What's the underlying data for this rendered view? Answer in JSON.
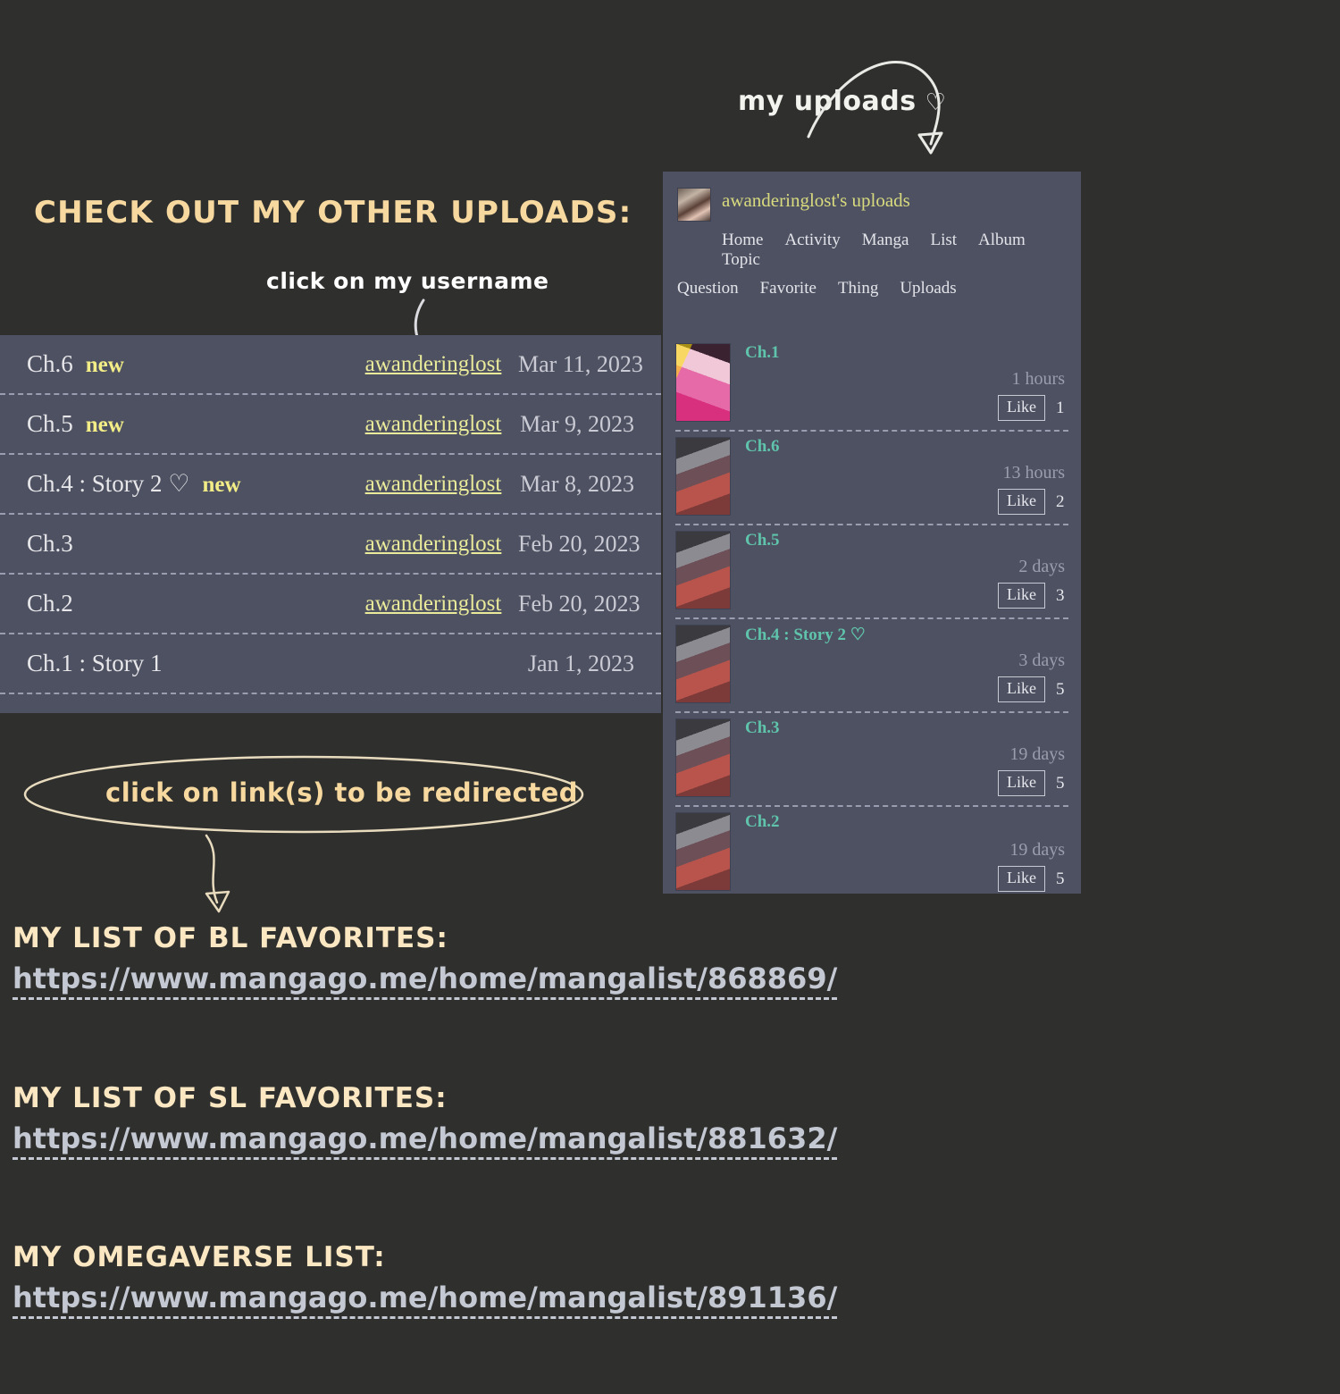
{
  "annotations": {
    "my_uploads": "my uploads",
    "my_uploads_heart": "♡",
    "check_out_heading": "CHECK OUT MY OTHER UPLOADS:",
    "click_username": "click on my username",
    "click_links": "click on link(s) to be redirected"
  },
  "chapter_table": {
    "rows": [
      {
        "title": "Ch.6",
        "badge": "new",
        "user": "awanderinglost",
        "date": "Mar 11, 2023"
      },
      {
        "title": "Ch.5",
        "badge": "new",
        "user": "awanderinglost",
        "date": "Mar 9, 2023"
      },
      {
        "title": "Ch.4 : Story 2 ♡",
        "badge": "new",
        "user": "awanderinglost",
        "date": "Mar 8, 2023"
      },
      {
        "title": "Ch.3",
        "badge": "",
        "user": "awanderinglost",
        "date": "Feb 20, 2023"
      },
      {
        "title": "Ch.2",
        "badge": "",
        "user": "awanderinglost",
        "date": "Feb 20, 2023"
      },
      {
        "title": "Ch.1 : Story 1",
        "badge": "",
        "user": "",
        "date": "Jan 1, 2023"
      }
    ]
  },
  "uploads_panel": {
    "title": "awanderinglost's uploads",
    "nav_line1": [
      {
        "label": "Home"
      },
      {
        "label": "Activity"
      },
      {
        "label": "Manga"
      },
      {
        "label": "List"
      },
      {
        "label": "Album"
      },
      {
        "label": "Topic"
      }
    ],
    "nav_line2": [
      {
        "label": "Question"
      },
      {
        "label": "Favorite"
      },
      {
        "label": "Thing"
      },
      {
        "label": "Uploads"
      }
    ],
    "like_label": "Like",
    "rows": [
      {
        "chapter": "Ch.1",
        "time": "1 hours",
        "likes": "1",
        "thumb": "manga-cover-pink"
      },
      {
        "chapter": "Ch.6",
        "time": "13 hours",
        "likes": "2",
        "thumb": "manga-cover-red"
      },
      {
        "chapter": "Ch.5",
        "time": "2 days",
        "likes": "3",
        "thumb": "manga-cover-red"
      },
      {
        "chapter": "Ch.4 : Story 2 ♡",
        "time": "3 days",
        "likes": "5",
        "thumb": "manga-cover-red"
      },
      {
        "chapter": "Ch.3",
        "time": "19 days",
        "likes": "5",
        "thumb": "manga-cover-red"
      },
      {
        "chapter": "Ch.2",
        "time": "19 days",
        "likes": "5",
        "thumb": "manga-cover-red"
      }
    ]
  },
  "link_lists": [
    {
      "heading": "MY LIST OF BL FAVORITES:",
      "url": "https://www.mangago.me/home/mangalist/868869/"
    },
    {
      "heading": "MY LIST OF SL FAVORITES:",
      "url": "https://www.mangago.me/home/mangalist/881632/"
    },
    {
      "heading": "MY OMEGAVERSE LIST:",
      "url": "https://www.mangago.me/home/mangalist/891136/"
    }
  ],
  "colors": {
    "page_background": "#2f2f2d",
    "panel_background": "#4e5162",
    "accent_cream": "#f7d9a0",
    "accent_yellow": "#f2ed86",
    "accent_teal": "#5fc4ab",
    "link_yellow": "#e9ea9a",
    "url_grey": "#c3c8d2"
  }
}
